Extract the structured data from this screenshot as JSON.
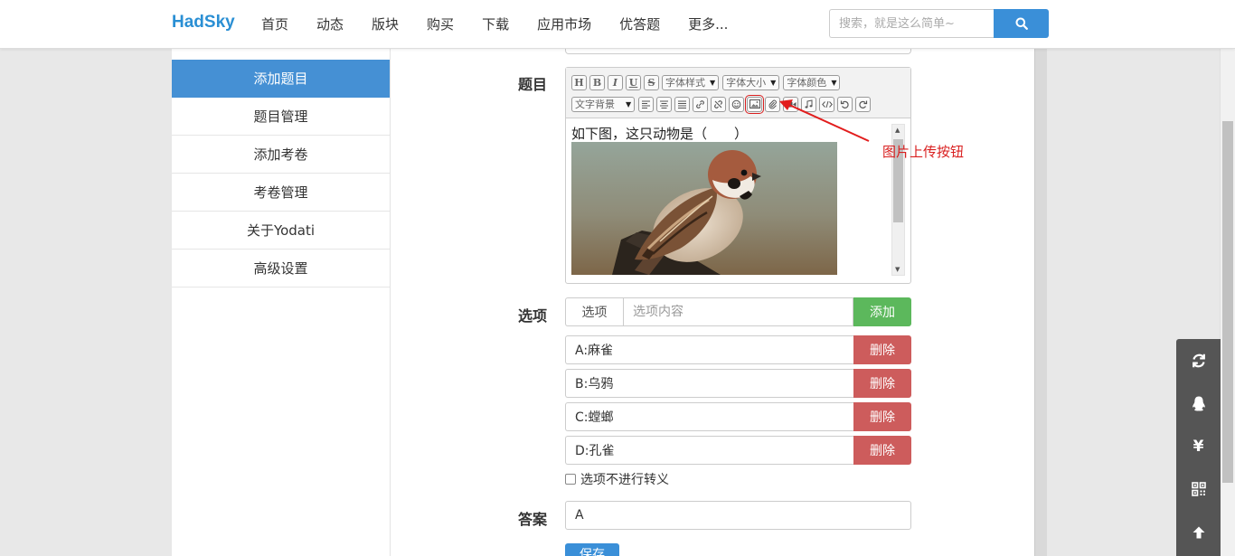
{
  "app": {
    "logo": "HadSky"
  },
  "nav": {
    "items": [
      "首页",
      "动态",
      "版块",
      "购买",
      "下载",
      "应用市场",
      "优答题",
      "更多..."
    ]
  },
  "search": {
    "placeholder": "搜索，就是这么简单~",
    "icon": "search-icon"
  },
  "sidebar": {
    "items": [
      {
        "label": "添加题目",
        "active": true
      },
      {
        "label": "题目管理",
        "active": false
      },
      {
        "label": "添加考卷",
        "active": false
      },
      {
        "label": "考卷管理",
        "active": false
      },
      {
        "label": "关于Yodati",
        "active": false
      },
      {
        "label": "高级设置",
        "active": false
      }
    ]
  },
  "form": {
    "question_label": "题目",
    "options_label": "选项",
    "answer_label": "答案",
    "editor": {
      "toolbar_row1": [
        "H",
        "B",
        "I",
        "U",
        "S"
      ],
      "selects": [
        "字体样式",
        "字体大小",
        "字体颜色",
        "文字背景"
      ],
      "content_text": "如下图，这只动物是（　　）",
      "image_icon": "image-icon"
    },
    "annotation": "图片上传按钮",
    "new_option": {
      "key": "选项",
      "placeholder": "选项内容",
      "add_label": "添加"
    },
    "options": [
      {
        "text": "A:麻雀",
        "delete_label": "删除"
      },
      {
        "text": "B:乌鸦",
        "delete_label": "删除"
      },
      {
        "text": "C:螳螂",
        "delete_label": "删除"
      },
      {
        "text": "D:孔雀",
        "delete_label": "删除"
      }
    ],
    "no_escape_checkbox": "选项不进行转义",
    "answer_value": "A",
    "save_label": "保存"
  },
  "float_tools": [
    "refresh-icon",
    "qq-icon",
    "yen-icon",
    "qrcode-icon",
    "arrow-up-icon"
  ],
  "colors": {
    "brand": "#2a8fd4",
    "primary": "#3a8fd8",
    "success": "#5cb85c",
    "danger": "#cd5c5c",
    "annotation": "#d91f1f"
  }
}
